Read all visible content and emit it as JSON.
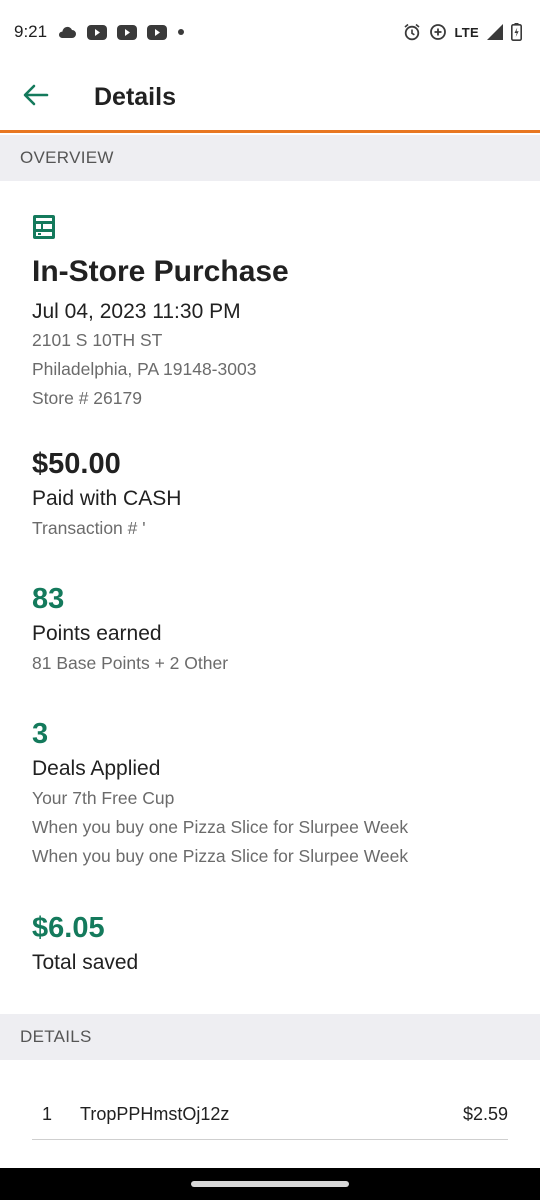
{
  "status_bar": {
    "time": "9:21",
    "network": "LTE",
    "left_icons": [
      "cloud-icon",
      "youtube-icon",
      "youtube-icon",
      "youtube-icon",
      "dot-icon"
    ],
    "right_icons": [
      "alarm-icon",
      "data-saver-icon",
      "signal-icon",
      "battery-icon"
    ]
  },
  "app_bar": {
    "title": "Details",
    "back_icon": "arrow-left-icon",
    "accent_color": "#e87722",
    "icon_color": "#147a5c"
  },
  "overview": {
    "header": "OVERVIEW",
    "icon": "store-icon",
    "purchase_type": "In-Store Purchase",
    "datetime": "Jul 04, 2023 11:30 PM",
    "address_line1": "2101 S 10TH ST",
    "address_line2": "Philadelphia, PA 19148-3003",
    "store": "Store # 26179",
    "amount": "$50.00",
    "payment": "Paid with CASH",
    "transaction": "Transaction # '",
    "points": "83",
    "points_label": "Points earned",
    "points_detail": "81 Base Points + 2 Other",
    "deals_count": "3",
    "deals_label": "Deals Applied",
    "deals": [
      "Your 7th Free Cup",
      "When you buy one Pizza Slice for Slurpee Week",
      "When you buy one Pizza Slice for Slurpee Week"
    ],
    "saved": "$6.05",
    "saved_label": "Total saved",
    "highlight_color": "#147a5c"
  },
  "details": {
    "header": "DETAILS",
    "items": [
      {
        "qty": "1",
        "name": "TropPPHmstOj12z",
        "price": "$2.59"
      }
    ]
  }
}
